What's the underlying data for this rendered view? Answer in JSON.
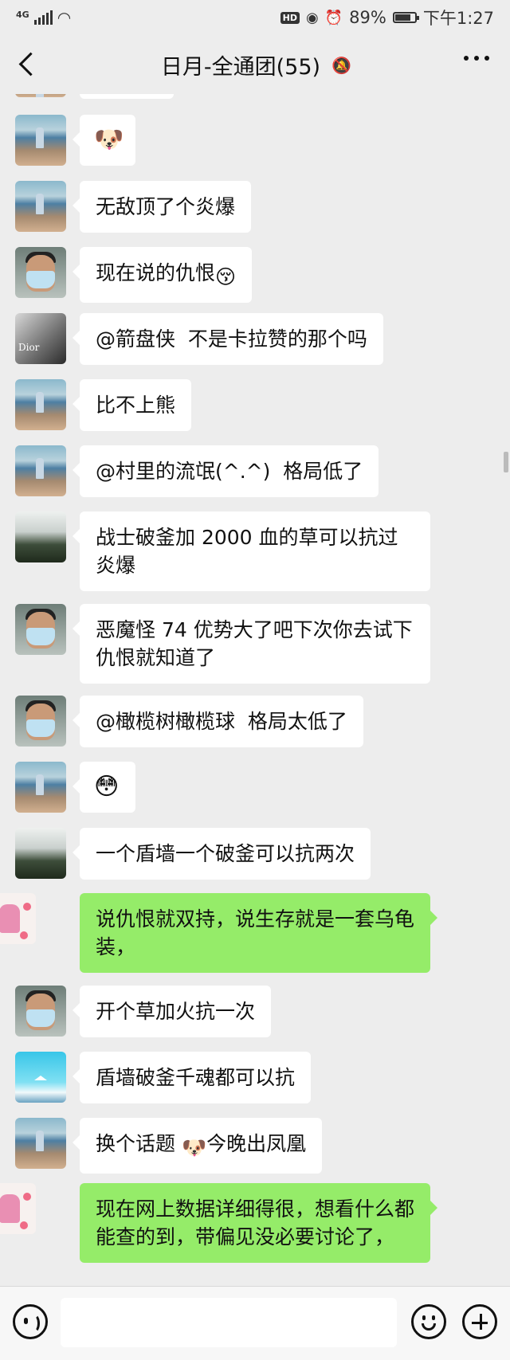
{
  "status_bar": {
    "network": "4G",
    "hd_badge": "HD",
    "battery": "89%",
    "battery_level": 0.89,
    "time": "下午1:27"
  },
  "header": {
    "title": "日月-全通团(55)"
  },
  "messages": [
    {
      "id": "m1",
      "side": "in",
      "avatar": "beach",
      "text": "",
      "emoji": "doge"
    },
    {
      "id": "m2",
      "side": "in",
      "avatar": "beach",
      "text": "无敌顶了个炎爆"
    },
    {
      "id": "m3",
      "side": "in",
      "avatar": "mask-man",
      "text": "现在说的仇恨",
      "emoji": "kissing-face"
    },
    {
      "id": "m4",
      "side": "in",
      "avatar": "dior",
      "text": "@箭盘侠  不是卡拉赞的那个吗"
    },
    {
      "id": "m5",
      "side": "in",
      "avatar": "beach",
      "text": "比不上熊"
    },
    {
      "id": "m6",
      "side": "in",
      "avatar": "beach",
      "text": "@村里的流氓(^.^)  格局低了"
    },
    {
      "id": "m7",
      "side": "in",
      "avatar": "tree",
      "text": "战士破釜加 2000 血的草可以抗过炎爆"
    },
    {
      "id": "m8",
      "side": "in",
      "avatar": "mask-man",
      "text": "恶魔怪 74 优势大了吧下次你去试下仇恨就知道了"
    },
    {
      "id": "m9",
      "side": "in",
      "avatar": "mask-man",
      "text": "@橄榄树橄榄球  格局太低了"
    },
    {
      "id": "m10",
      "side": "in",
      "avatar": "beach",
      "text": "",
      "emoji": "blush-face"
    },
    {
      "id": "m11",
      "side": "in",
      "avatar": "tree",
      "text": "一个盾墙一个破釜可以抗两次"
    },
    {
      "id": "m12",
      "side": "out",
      "avatar": "pink-drawing",
      "text": "说仇恨就双持，说生存就是一套乌龟装，"
    },
    {
      "id": "m13",
      "side": "in",
      "avatar": "mask-man",
      "text": "开个草加火抗一次"
    },
    {
      "id": "m14",
      "side": "in",
      "avatar": "sky",
      "text": "盾墙破釜千魂都可以抗"
    },
    {
      "id": "m15",
      "side": "in",
      "avatar": "beach",
      "text_before": "换个话题 ",
      "emoji": "doge",
      "text_after": "今晚出凤凰"
    },
    {
      "id": "m16",
      "side": "out",
      "avatar": "pink-drawing",
      "text": "现在网上数据详细得很，想看什么都能查的到，带偏见没必要讨论了，"
    }
  ],
  "input_bar": {
    "voice_icon": "voice-icon",
    "emoji_icon": "emoji-icon",
    "plus_icon": "plus-icon"
  },
  "colors": {
    "background": "#ededed",
    "incoming_bubble": "#ffffff",
    "outgoing_bubble": "#95ec69"
  }
}
